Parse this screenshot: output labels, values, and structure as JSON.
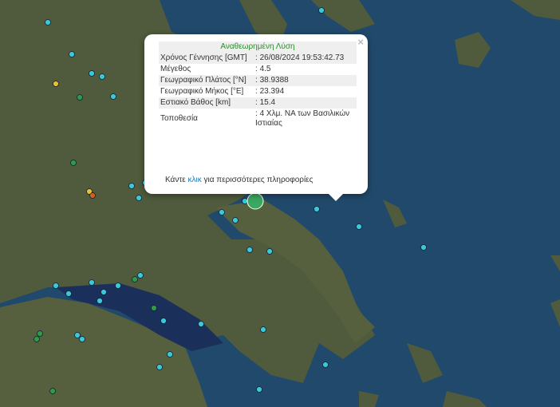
{
  "popup": {
    "title": "Αναθεωρημένη Λύση",
    "close_label": "×",
    "rows": [
      {
        "label": "Χρόνος Γέννησης [GMT]",
        "value": ": 26/08/2024 19:53:42.73"
      },
      {
        "label": "Μέγεθος",
        "value": ": 4.5"
      },
      {
        "label": "Γεωγραφικό Πλάτος [°N]",
        "value": ": 38.9388"
      },
      {
        "label": "Γεωγραφικό Μήκος [°E]",
        "value": ": 23.394"
      },
      {
        "label": "Εστιακό Βάθος [km]",
        "value": ": 15.4"
      },
      {
        "label": "Τοποθεσία",
        "value": ": 4 Χλμ. ΝΑ των Βασιλικών Ιστιαίας"
      }
    ],
    "footer_pre": "Κάντε ",
    "footer_link": "κλικ",
    "footer_post": " για περισσότερες πληροφορίες"
  },
  "colors": {
    "sea": "#21496b",
    "land": "#4f5b3c",
    "marker_cyan": "#3cc8d8",
    "marker_green": "#2f9a4a",
    "marker_yellow": "#e8c030",
    "marker_orange": "#d06020",
    "selected": "#3aa860"
  }
}
